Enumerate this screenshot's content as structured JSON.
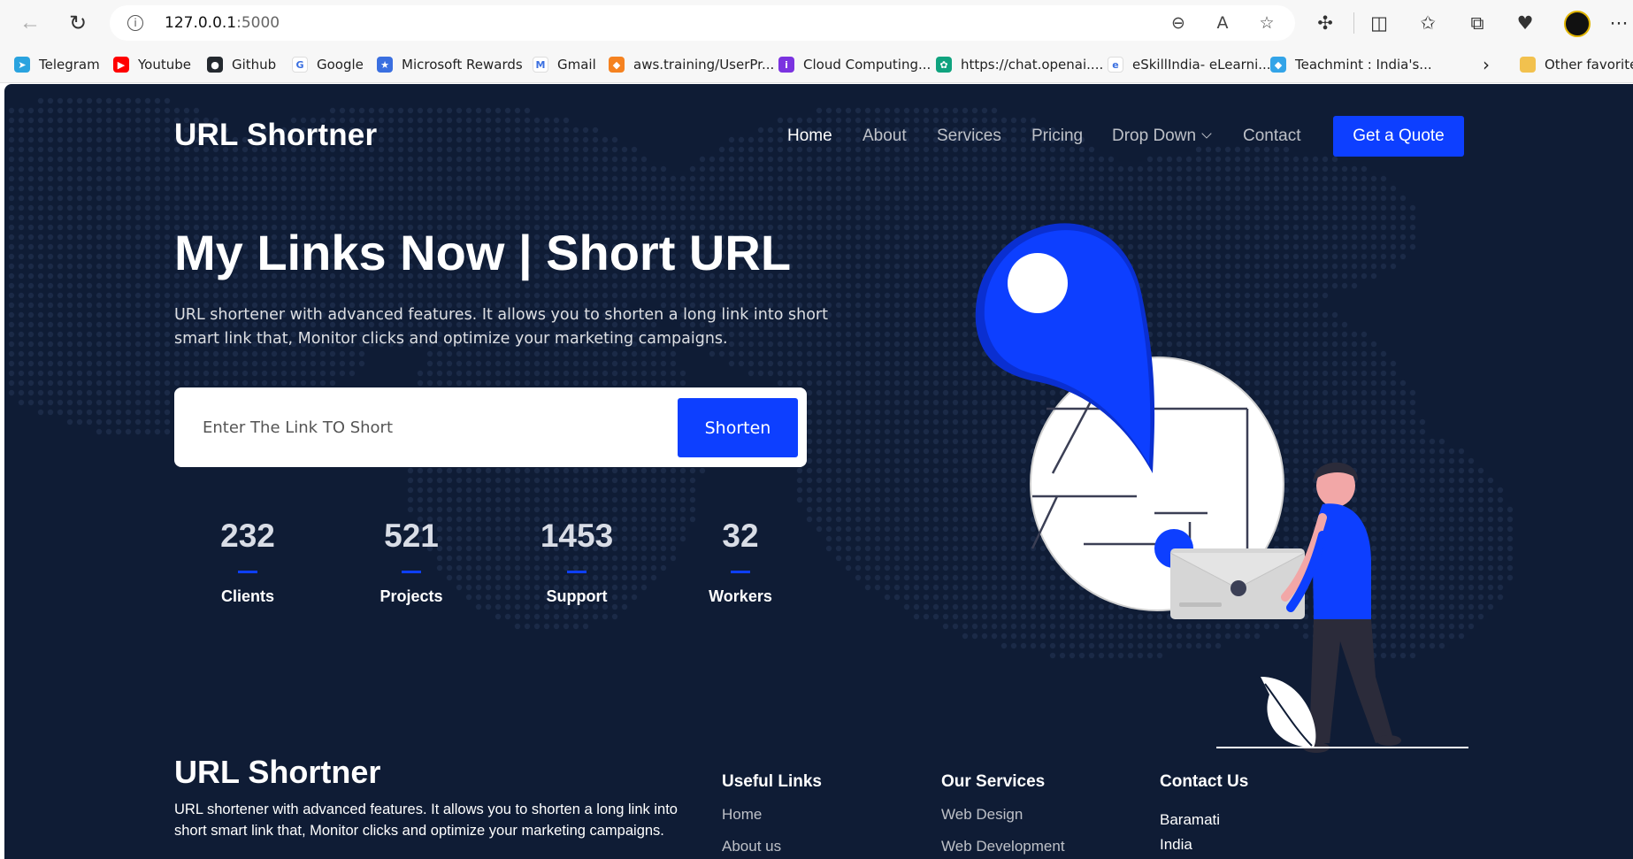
{
  "browser": {
    "url_host": "127.0.0.1",
    "url_port": ":5000",
    "bookmarks": [
      {
        "label": "Telegram",
        "color": "#2aa3df",
        "glyph": "➤"
      },
      {
        "label": "Youtube",
        "color": "#ff0000",
        "glyph": "▶"
      },
      {
        "label": "Github",
        "color": "#24292f",
        "glyph": "●"
      },
      {
        "label": "Google",
        "color": "#ffffff",
        "glyph": "G"
      },
      {
        "label": "Microsoft Rewards",
        "color": "#3a6fe0",
        "glyph": "★"
      },
      {
        "label": "Gmail",
        "color": "#ffffff",
        "glyph": "M"
      },
      {
        "label": "aws.training/UserPr...",
        "color": "#f58220",
        "glyph": "◆"
      },
      {
        "label": "Cloud Computing...",
        "color": "#7b33e0",
        "glyph": "i"
      },
      {
        "label": "https://chat.openai....",
        "color": "#10a37f",
        "glyph": "✿"
      },
      {
        "label": "eSkillIndia- eLearni...",
        "color": "#ffffff",
        "glyph": "e"
      },
      {
        "label": "Teachmint : India's...",
        "color": "#33a4e8",
        "glyph": "◆"
      }
    ],
    "other_favorites": "Other favorites"
  },
  "site": {
    "brand": "URL Shortner",
    "nav": [
      "Home",
      "About",
      "Services",
      "Pricing",
      "Drop Down",
      "Contact"
    ],
    "quote_button": "Get a Quote",
    "accent_color": "#0d3fff",
    "background_color": "#0f1c35"
  },
  "hero": {
    "title": "My Links Now | Short URL",
    "description": "URL shortener with advanced features. It allows you to shorten a long link into short smart link that, Monitor clicks and optimize your marketing campaigns.",
    "input_placeholder": "Enter The Link TO Short",
    "shorten_button": "Shorten"
  },
  "stats": [
    {
      "number": "232",
      "label": "Clients"
    },
    {
      "number": "521",
      "label": "Projects"
    },
    {
      "number": "1453",
      "label": "Support"
    },
    {
      "number": "32",
      "label": "Workers"
    }
  ],
  "footer": {
    "brand": "URL Shortner",
    "description": "URL shortener with advanced features. It allows you to shorten a long link into short smart link that, Monitor clicks and optimize your marketing campaigns.",
    "useful_links": {
      "title": "Useful Links",
      "items": [
        "Home",
        "About us"
      ]
    },
    "services": {
      "title": "Our Services",
      "items": [
        "Web Design",
        "Web Development"
      ]
    },
    "contact": {
      "title": "Contact Us",
      "lines": [
        "Baramati",
        "India"
      ]
    }
  }
}
